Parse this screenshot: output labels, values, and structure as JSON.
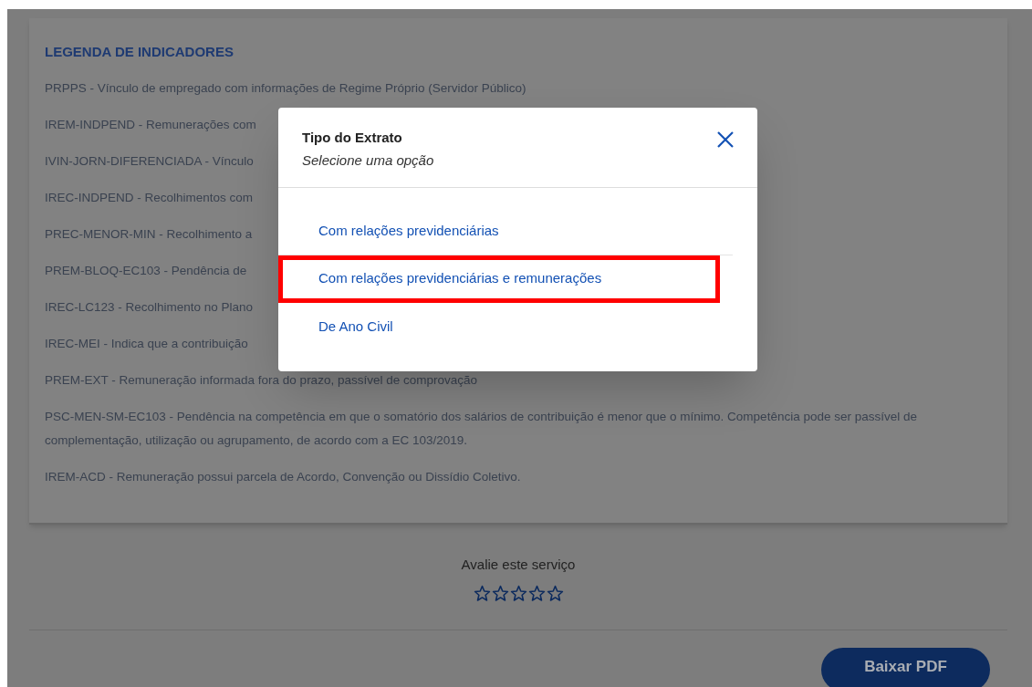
{
  "legend": {
    "title": "LEGENDA DE INDICADORES",
    "items": [
      "PRPPS - Vínculo de empregado com informações de Regime Próprio (Servidor Público)",
      "IREM-INDPEND - Remunerações com",
      "IVIN-JORN-DIFERENCIADA - Vínculo",
      "IREC-INDPEND - Recolhimentos com",
      "PREC-MENOR-MIN - Recolhimento a",
      "PREM-BLOQ-EC103 - Pendência de",
      "IREC-LC123 - Recolhimento no Plano",
      "IREC-MEI - Indica que a contribuição",
      "PREM-EXT - Remuneração informada fora do prazo, passível de comprovação",
      "PSC-MEN-SM-EC103 - Pendência na competência em que o somatório dos salários de contribuição é menor que o mínimo. Competência pode ser passível de complementação, utilização ou agrupamento, de acordo com a EC 103/2019.",
      "IREM-ACD - Remuneração possui parcela de Acordo, Convenção ou Dissídio Coletivo."
    ]
  },
  "rating": {
    "label": "Avalie este serviço",
    "stars": 0
  },
  "download_button": "Baixar PDF",
  "modal": {
    "title": "Tipo do Extrato",
    "subtitle": "Selecione uma opção",
    "options": [
      {
        "label": "Com relações previdenciárias",
        "highlighted": false
      },
      {
        "label": "Com relações previdenciárias e remunerações",
        "highlighted": true
      },
      {
        "label": "De Ano Civil",
        "highlighted": false
      }
    ]
  }
}
